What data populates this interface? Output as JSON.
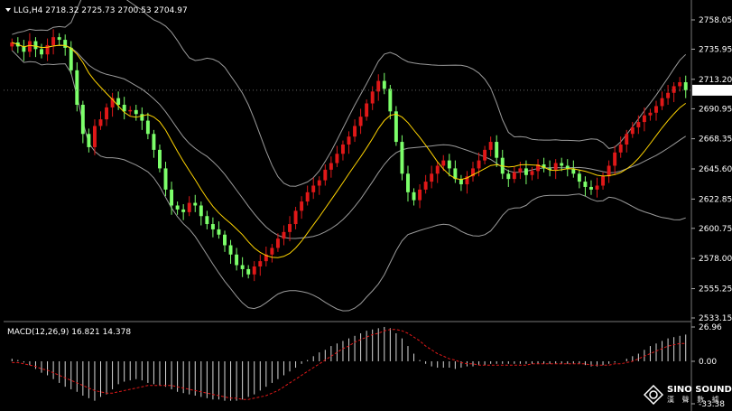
{
  "chart_data": [
    {
      "type": "candlestick",
      "symbol_header": "LLG,H4  2718.32 2725.73 2700.53 2704.97",
      "current_price": "2704.97",
      "y_ticks": [
        "2758.05",
        "2735.95",
        "2713.20",
        "2690.95",
        "2668.35",
        "2645.60",
        "2622.85",
        "2600.75",
        "2578.00",
        "2555.25",
        "2533.15"
      ],
      "ylim": [
        2533.15,
        2758.05
      ],
      "colors": {
        "up": "#e01818",
        "down": "#7cff6a",
        "ma": "#ffd400",
        "bands": "#9a9a9a",
        "price_line": "#ffffff"
      },
      "closes": [
        2741,
        2738,
        2734,
        2742,
        2736,
        2732,
        2739,
        2745,
        2743,
        2737,
        2720,
        2694,
        2672,
        2662,
        2678,
        2683,
        2692,
        2699,
        2694,
        2689,
        2690,
        2687,
        2682,
        2672,
        2660,
        2646,
        2630,
        2618,
        2615,
        2613,
        2620,
        2618,
        2610,
        2604,
        2600,
        2596,
        2588,
        2581,
        2573,
        2570,
        2566,
        2572,
        2576,
        2581,
        2586,
        2593,
        2598,
        2604,
        2614,
        2621,
        2628,
        2633,
        2637,
        2645,
        2650,
        2657,
        2664,
        2670,
        2678,
        2685,
        2695,
        2704,
        2712,
        2706,
        2689,
        2666,
        2642,
        2628,
        2622,
        2630,
        2636,
        2642,
        2648,
        2652,
        2646,
        2638,
        2634,
        2640,
        2646,
        2652,
        2660,
        2666,
        2654,
        2642,
        2638,
        2643,
        2646,
        2641,
        2644,
        2649,
        2646,
        2645,
        2650,
        2648,
        2646,
        2642,
        2636,
        2632,
        2630,
        2633,
        2640,
        2648,
        2658,
        2664,
        2672,
        2677,
        2681,
        2686,
        2688,
        2693,
        2699,
        2703,
        2708,
        2711,
        2705
      ],
      "ma_period": 10,
      "bands_period": 20,
      "bands_dev": 2
    },
    {
      "type": "bar",
      "label": "MACD(12,26,9) 16.821 14.378",
      "y_ticks": [
        "26.96",
        "0.00",
        "-33.38"
      ],
      "ylim": [
        -33.38,
        26.96
      ],
      "colors": {
        "histogram": "#d8d8d8",
        "signal": "#e01818"
      },
      "values": [
        2,
        1,
        -1,
        -3,
        -6,
        -9,
        -11,
        -14,
        -17,
        -20,
        -22,
        -24,
        -27,
        -29,
        -31,
        -28,
        -26,
        -22,
        -18,
        -16,
        -15,
        -14,
        -15,
        -17,
        -18,
        -19,
        -20,
        -22,
        -24,
        -25,
        -26,
        -27,
        -28,
        -29,
        -30,
        -30,
        -31,
        -31,
        -31,
        -30,
        -28,
        -26,
        -23,
        -20,
        -17,
        -14,
        -11,
        -8,
        -5,
        -2,
        1,
        4,
        7,
        9,
        12,
        14,
        16,
        18,
        20,
        22,
        24,
        25,
        26,
        27,
        26,
        22,
        18,
        12,
        6,
        1,
        -2,
        -4,
        -5,
        -5,
        -5,
        -6,
        -5,
        -4,
        -4,
        -3,
        -3,
        -2,
        -2,
        -2,
        -2,
        -2,
        -2,
        -2,
        -2,
        -2,
        -2,
        -2,
        -2,
        -2,
        -2,
        -2,
        -2,
        -3,
        -4,
        -4,
        -3,
        -2,
        -1,
        0,
        2,
        4,
        6,
        9,
        12,
        14,
        16,
        18,
        19,
        20,
        21
      ],
      "signal": [
        -1,
        -1,
        -2,
        -3,
        -4,
        -6,
        -7,
        -9,
        -11,
        -13,
        -15,
        -17,
        -19,
        -21,
        -23,
        -24,
        -25,
        -25,
        -24,
        -23,
        -22,
        -21,
        -20,
        -19,
        -19,
        -19,
        -19,
        -19,
        -20,
        -21,
        -22,
        -23,
        -24,
        -25,
        -26,
        -27,
        -28,
        -29,
        -29,
        -30,
        -30,
        -29,
        -28,
        -27,
        -25,
        -23,
        -20,
        -17,
        -14,
        -11,
        -8,
        -5,
        -2,
        1,
        4,
        7,
        10,
        12,
        15,
        17,
        19,
        21,
        22,
        24,
        25,
        25,
        24,
        22,
        19,
        16,
        12,
        9,
        6,
        4,
        2,
        1,
        -1,
        -2,
        -2,
        -3,
        -3,
        -3,
        -3,
        -3,
        -3,
        -3,
        -3,
        -3,
        -2,
        -2,
        -2,
        -2,
        -2,
        -2,
        -2,
        -2,
        -2,
        -2,
        -3,
        -3,
        -3,
        -3,
        -2,
        -2,
        -1,
        0,
        2,
        4,
        6,
        8,
        10,
        12,
        13,
        14,
        14
      ]
    }
  ],
  "watermark": {
    "name": "SINO SOUND",
    "sub": "漢 聲 數 據"
  }
}
